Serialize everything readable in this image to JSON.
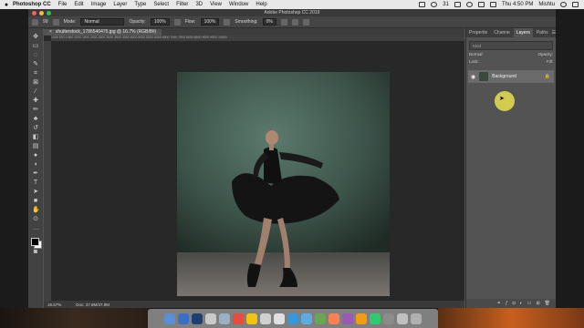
{
  "menubar": {
    "apple": "",
    "items": [
      "Photoshop CC",
      "File",
      "Edit",
      "Image",
      "Layer",
      "Type",
      "Select",
      "Filter",
      "3D",
      "View",
      "Window",
      "Help"
    ],
    "battery": "31",
    "clock": "Thu 4:50 PM",
    "user": "Mishtu"
  },
  "window": {
    "title": "Adobe Photoshop CC 2019",
    "light_colors": [
      "#fe5f57",
      "#febc2e",
      "#28c840"
    ]
  },
  "options": {
    "brush_size": "99",
    "mode_label": "Mode:",
    "mode_value": "Normal",
    "opacity_label": "Opacity:",
    "opacity_value": "100%",
    "flow_label": "Flow:",
    "flow_value": "100%",
    "smoothing_label": "Smoothing:",
    "smoothing_value": "0%"
  },
  "document": {
    "tab_label": "shutterstock_1786540475.jpg @ 16.7% (RGB/8#)",
    "tab_close": "×",
    "ruler_top": "1000  500  0  500  1000  1500  2000  2500  3000  3500  4000  4500  5000  5500  6000  6500  7000  7500  8000  8500  9000  9500  10000",
    "zoom": "16.67%",
    "doc_info": "Doc: 37.9M/37.9M"
  },
  "panels": {
    "tabs": [
      "Propertie",
      "Channe",
      "Layers",
      "Paths"
    ],
    "active_tab": "Layers",
    "menu_icon": "☰",
    "filter_label": "Kind",
    "blend_mode": "Normal",
    "opacity_label": "Opacity:",
    "lock_label": "Lock:",
    "fill_label": "Fill:",
    "layers": [
      {
        "name": "Background",
        "visible": true,
        "locked": true
      }
    ],
    "footer_icons": [
      "link-icon",
      "fx-icon",
      "mask-icon",
      "adjustment-icon",
      "group-icon",
      "new-layer-icon",
      "trash-icon"
    ]
  },
  "toolbar": {
    "tools": [
      "move-icon",
      "marquee-icon",
      "lasso-icon",
      "quick-select-icon",
      "crop-icon",
      "frame-icon",
      "eyedropper-icon",
      "healing-icon",
      "brush-icon",
      "clone-icon",
      "history-brush-icon",
      "eraser-icon",
      "gradient-icon",
      "blur-icon",
      "dodge-icon",
      "pen-icon",
      "type-icon",
      "path-select-icon",
      "shape-icon",
      "hand-icon",
      "zoom-icon",
      "more-icon"
    ]
  },
  "dock": {
    "app_colors": [
      "#5a8fd6",
      "#3a6fc8",
      "#1f3f73",
      "#c9c9c9",
      "#9bb0c4",
      "#e84c3d",
      "#f1c40f",
      "#d0d0d0",
      "#e0e0e0",
      "#3498db",
      "#5dade2",
      "#6aa84f",
      "#ff7f50",
      "#9b59b6",
      "#f39c12",
      "#2ecc71",
      "#8b8b8b",
      "#c0c0c0",
      "#b0b0b0"
    ]
  }
}
